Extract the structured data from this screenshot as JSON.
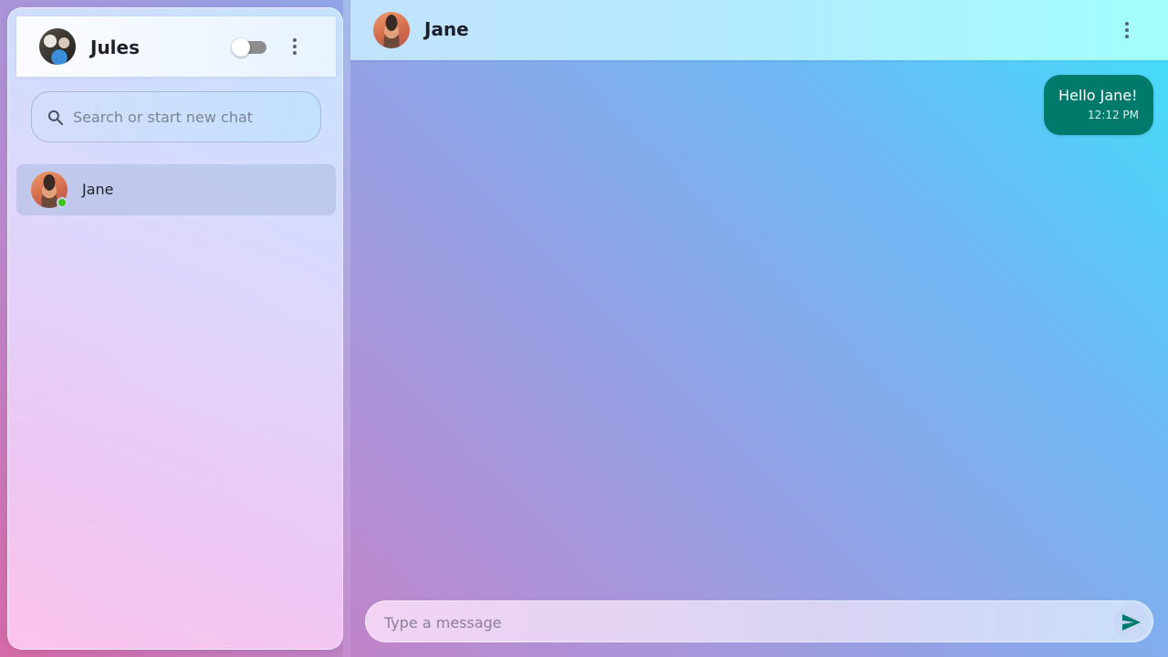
{
  "sidebar": {
    "profile": {
      "name": "Jules",
      "theme_toggle": "off"
    },
    "search": {
      "placeholder": "Search or start new chat",
      "value": ""
    },
    "chats": [
      {
        "name": "Jane",
        "status": "online"
      }
    ]
  },
  "conversation": {
    "contact_name": "Jane",
    "messages": [
      {
        "text": "Hello Jane!",
        "time": "12:12 PM",
        "direction": "outgoing"
      }
    ],
    "composer": {
      "placeholder": "Type a message",
      "value": ""
    }
  },
  "icons": {
    "menu": "more-vertical-icon",
    "search": "search-icon",
    "send": "send-icon"
  },
  "colors": {
    "outgoing_bubble": "#007a6a",
    "online_indicator": "#3ec21a",
    "send_icon": "#007a6a"
  }
}
